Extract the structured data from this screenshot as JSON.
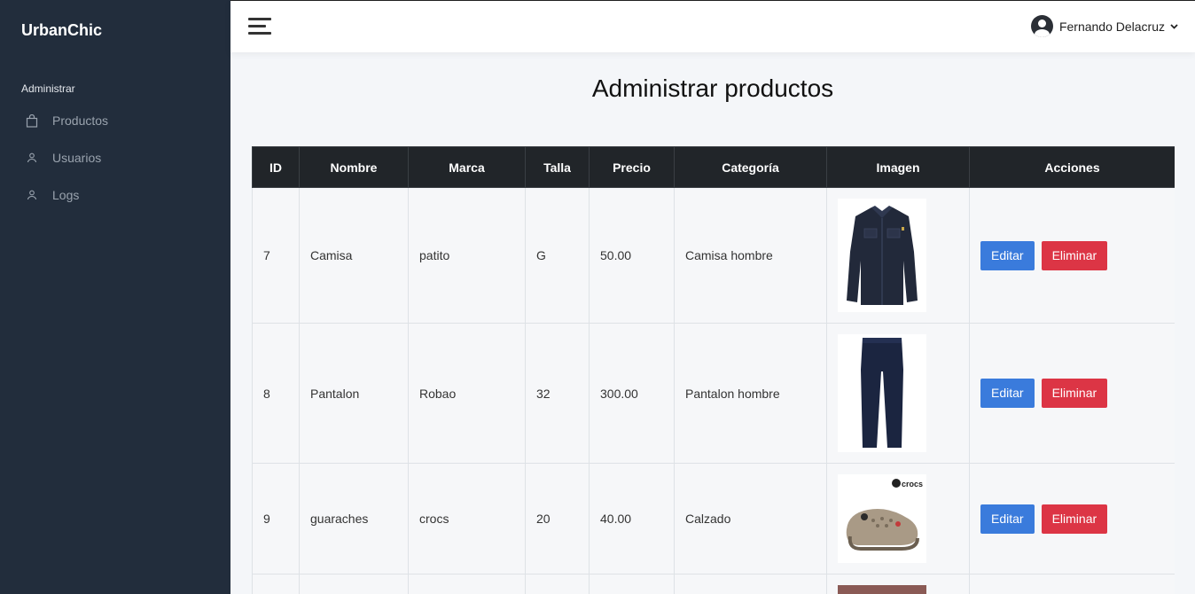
{
  "app": {
    "brand": "UrbanChic"
  },
  "sidebar": {
    "section": "Administrar",
    "items": [
      {
        "label": "Productos",
        "icon": "bag-icon"
      },
      {
        "label": "Usuarios",
        "icon": "user-icon"
      },
      {
        "label": "Logs",
        "icon": "user-icon"
      }
    ]
  },
  "header": {
    "user_name": "Fernando Delacruz"
  },
  "main": {
    "title": "Administrar productos",
    "columns": [
      "ID",
      "Nombre",
      "Marca",
      "Talla",
      "Precio",
      "Categoría",
      "Imagen",
      "Acciones"
    ],
    "rows": [
      {
        "id": "7",
        "nombre": "Camisa",
        "marca": "patito",
        "talla": "G",
        "precio": "50.00",
        "categoria": "Camisa hombre",
        "image": "shirt"
      },
      {
        "id": "8",
        "nombre": "Pantalon",
        "marca": "Robao",
        "talla": "32",
        "precio": "300.00",
        "categoria": "Pantalon hombre",
        "image": "pants"
      },
      {
        "id": "9",
        "nombre": "guaraches",
        "marca": "crocs",
        "talla": "20",
        "precio": "40.00",
        "categoria": "Calzado",
        "image": "crocs",
        "image_text": "crocs"
      }
    ],
    "actions": {
      "edit": "Editar",
      "delete": "Eliminar"
    }
  },
  "colors": {
    "sidebar": "#222d3c",
    "edit": "#3a7bdc",
    "delete": "#dc3545",
    "header_row": "#212529"
  }
}
